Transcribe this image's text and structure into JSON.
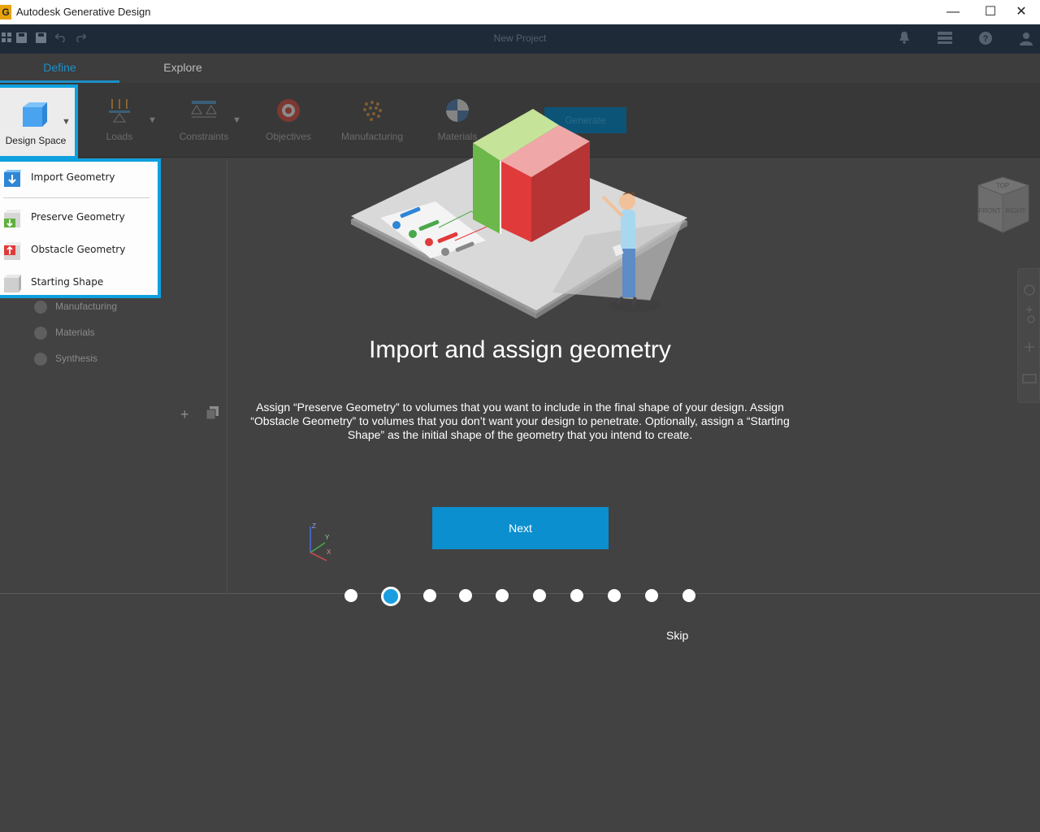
{
  "window": {
    "title": "Autodesk Generative Design",
    "app_icon_letter": "G",
    "controls": {
      "minimize": "—",
      "maximize": "☐",
      "close": "✕"
    }
  },
  "toolbar": {
    "project_name": "New Project"
  },
  "tabs": [
    {
      "label": "Define"
    },
    {
      "label": "Explore"
    }
  ],
  "ribbon": {
    "design_space": "Design Space",
    "loads": "Loads",
    "constraints": "Constraints",
    "objectives": "Objectives",
    "manufacturing": "Manufacturing",
    "materials": "Materials",
    "generate": "Generate"
  },
  "dropdown": {
    "items": [
      {
        "label": "Import Geometry",
        "icon": "import-geometry-icon"
      },
      {
        "label": "Preserve Geometry",
        "icon": "preserve-geometry-icon"
      },
      {
        "label": "Obstacle Geometry",
        "icon": "obstacle-geometry-icon"
      },
      {
        "label": "Starting Shape",
        "icon": "starting-shape-icon"
      }
    ]
  },
  "browser": {
    "items": [
      {
        "label": "Manufacturing"
      },
      {
        "label": "Materials"
      },
      {
        "label": "Synthesis"
      }
    ]
  },
  "onboarding": {
    "heading": "Import and assign geometry",
    "description": "Assign “Preserve Geometry” to volumes that you want to include in the final shape of your design. Assign “Obstacle Geometry” to volumes that you don’t want your design to penetrate. Optionally, assign a “Starting Shape” as the initial shape of the geometry that you intend to create.",
    "next_label": "Next",
    "skip_label": "Skip",
    "total_steps": 10,
    "current_step": 2
  },
  "viewcube": {
    "top": "TOP",
    "front": "FRONT",
    "right": "RIGHT"
  },
  "triad": {
    "z": "Z",
    "y": "Y",
    "x": "X"
  },
  "colors": {
    "accent": "#0fa1de",
    "next_button": "#0c8fcf",
    "preserve": "#6cc04a",
    "obstacle": "#e03a3a",
    "starting": "#cfcfcf"
  }
}
